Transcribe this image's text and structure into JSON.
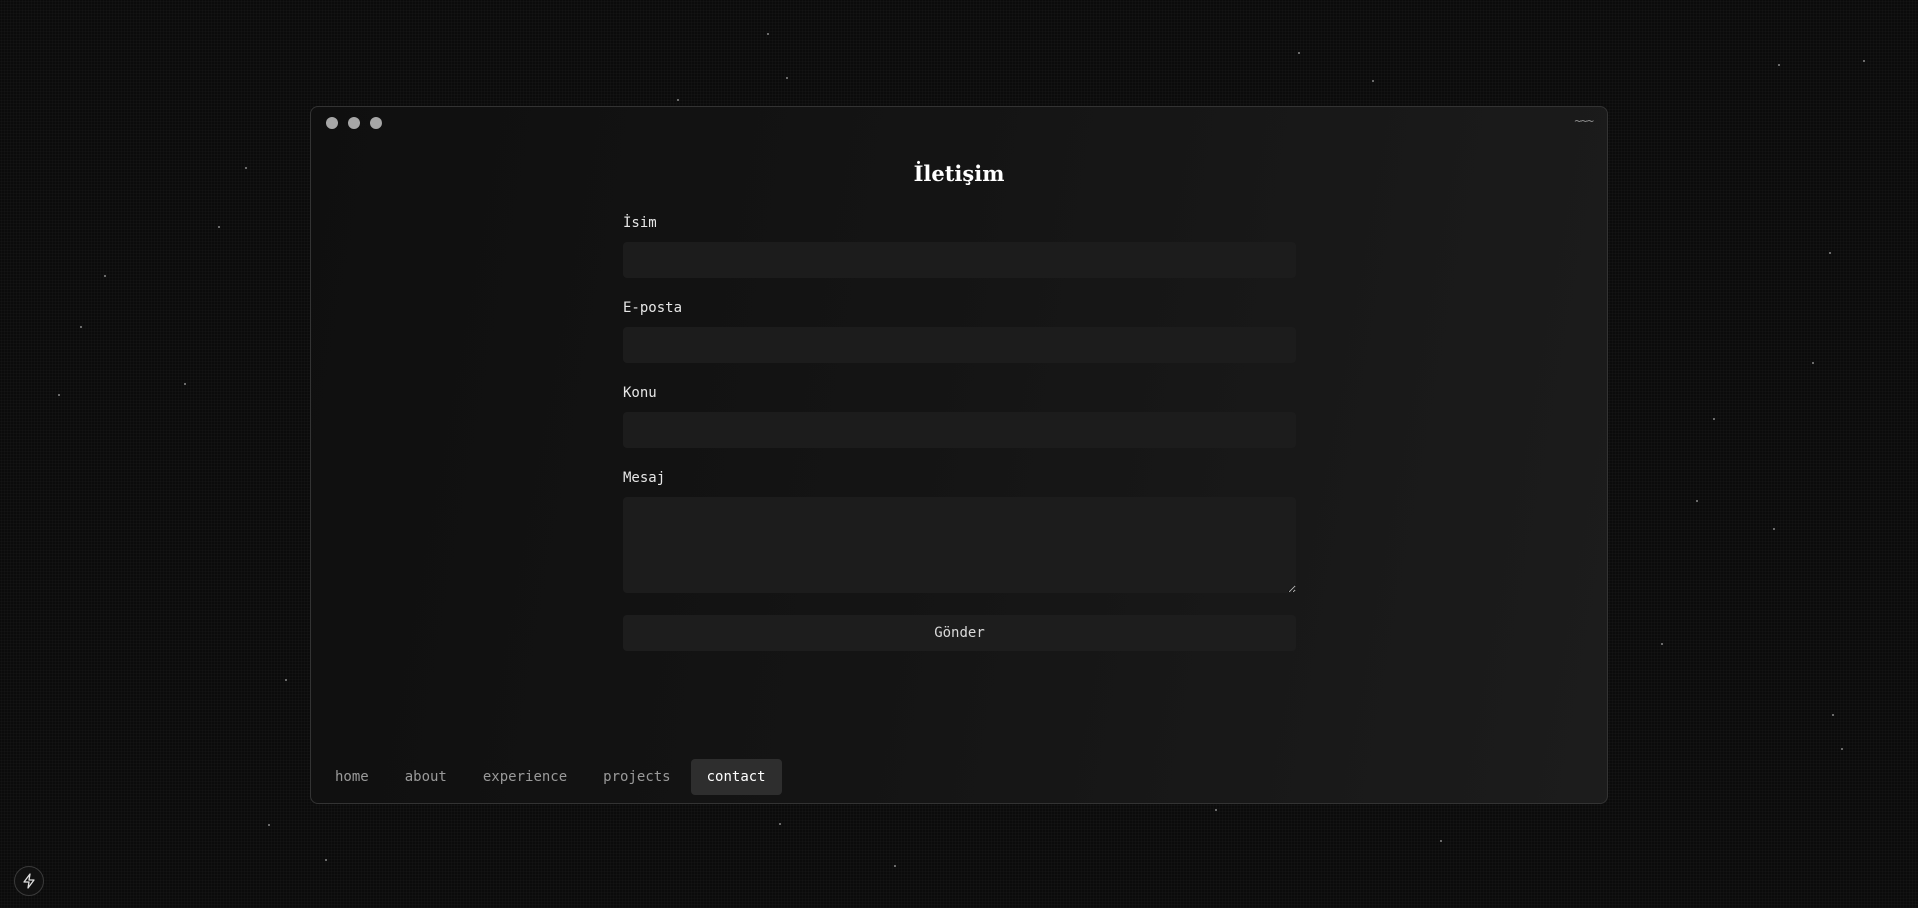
{
  "window": {
    "title_decoration": "~~~"
  },
  "page": {
    "heading": "İletişim"
  },
  "form": {
    "name": {
      "label": "İsim",
      "value": "",
      "placeholder": ""
    },
    "email": {
      "label": "E-posta",
      "value": "",
      "placeholder": ""
    },
    "subject": {
      "label": "Konu",
      "value": "",
      "placeholder": ""
    },
    "message": {
      "label": "Mesaj",
      "value": "",
      "placeholder": ""
    },
    "submit_label": "Gönder"
  },
  "nav": {
    "items": [
      {
        "label": "home",
        "active": false
      },
      {
        "label": "about",
        "active": false
      },
      {
        "label": "experience",
        "active": false
      },
      {
        "label": "projects",
        "active": false
      },
      {
        "label": "contact",
        "active": true
      }
    ]
  },
  "corner_button": {
    "icon": "lightning-icon"
  },
  "colors": {
    "background": "#0b0b0b",
    "window": "#141414",
    "field": "#1c1c1c",
    "active_nav": "#2e2e2e",
    "window_dots": "#a7a7a7"
  }
}
